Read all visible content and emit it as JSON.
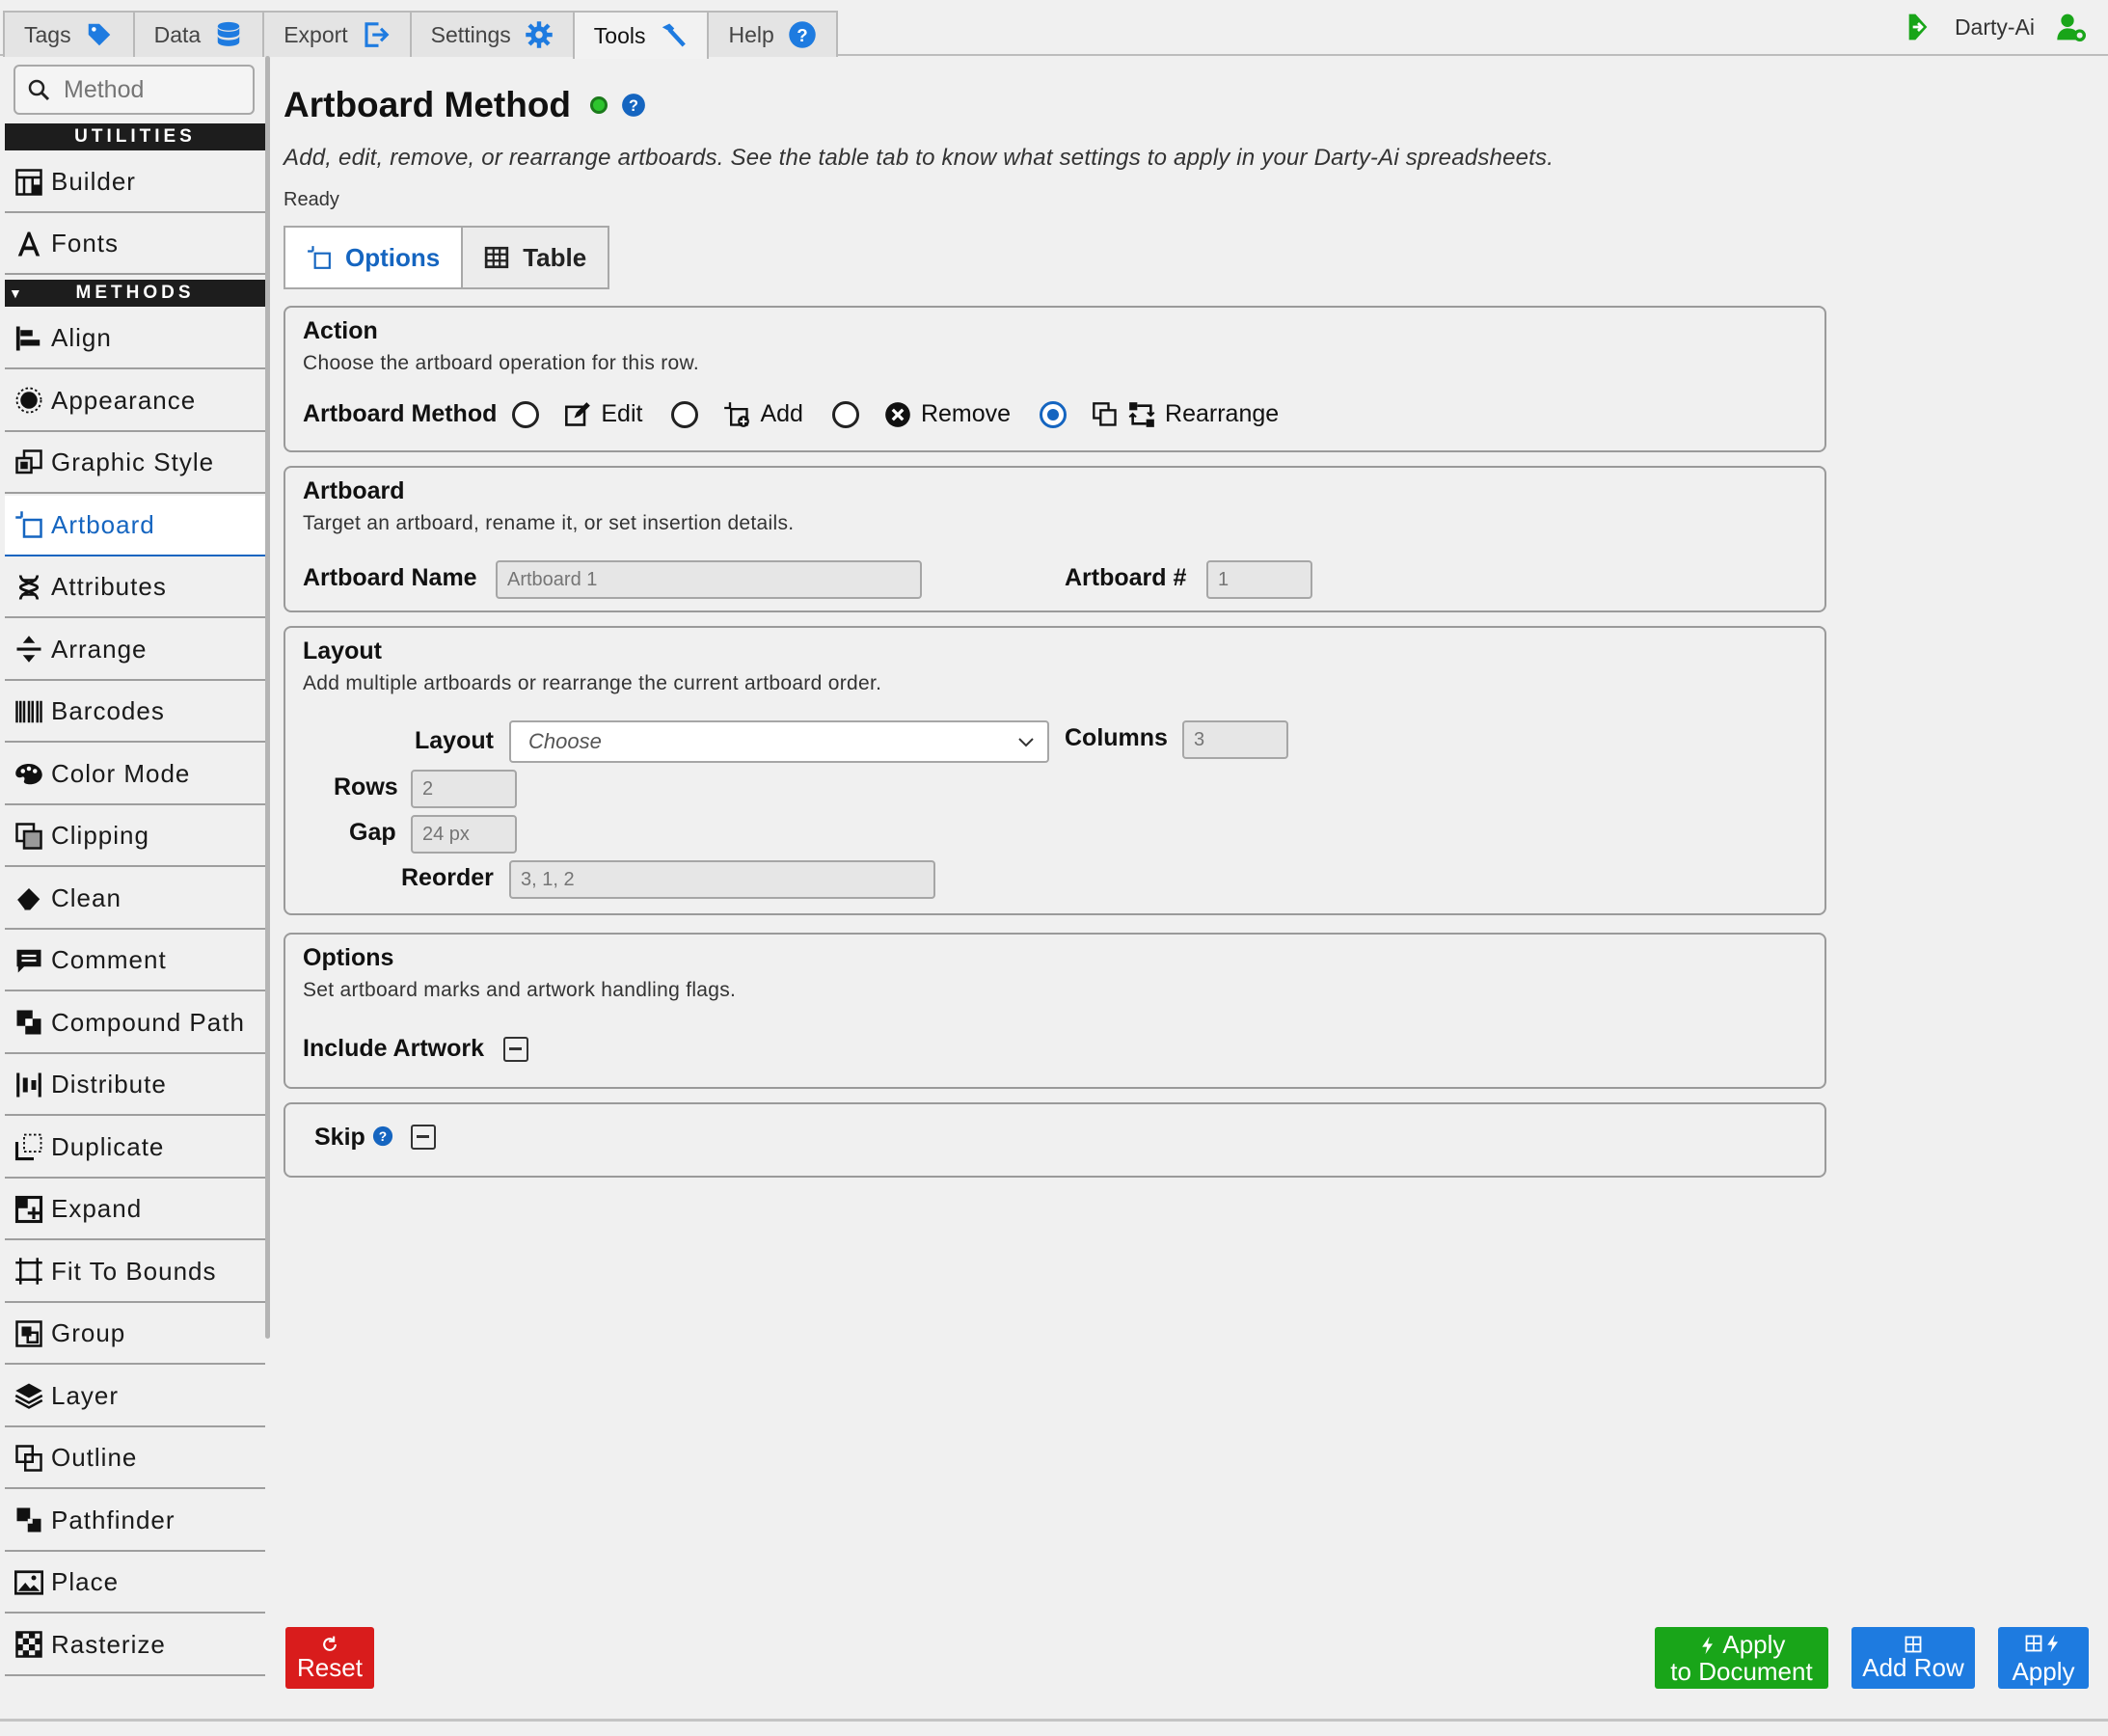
{
  "top_tabs": [
    {
      "label": "Tags",
      "icon": "tag-icon"
    },
    {
      "label": "Data",
      "icon": "database-icon"
    },
    {
      "label": "Export",
      "icon": "export-icon"
    },
    {
      "label": "Settings",
      "icon": "gear-icon"
    },
    {
      "label": "Tools",
      "icon": "hammer-icon",
      "active": true
    },
    {
      "label": "Help",
      "icon": "help-icon"
    }
  ],
  "user": {
    "name": "Darty-Ai"
  },
  "sidebar": {
    "search_placeholder": "Method",
    "utilities_header": "UTILITIES",
    "methods_header": "METHODS",
    "utilities": [
      {
        "label": "Builder",
        "icon": "builder-icon"
      },
      {
        "label": "Fonts",
        "icon": "font-icon"
      }
    ],
    "methods": [
      {
        "label": "Align",
        "icon": "align-icon"
      },
      {
        "label": "Appearance",
        "icon": "appearance-icon"
      },
      {
        "label": "Graphic Style",
        "icon": "graphic-style-icon"
      },
      {
        "label": "Artboard",
        "icon": "artboard-icon",
        "active": true
      },
      {
        "label": "Attributes",
        "icon": "dna-icon"
      },
      {
        "label": "Arrange",
        "icon": "arrange-icon"
      },
      {
        "label": "Barcodes",
        "icon": "barcode-icon"
      },
      {
        "label": "Color Mode",
        "icon": "palette-icon"
      },
      {
        "label": "Clipping",
        "icon": "clipping-icon"
      },
      {
        "label": "Clean",
        "icon": "eraser-icon"
      },
      {
        "label": "Comment",
        "icon": "comment-icon"
      },
      {
        "label": "Compound Path",
        "icon": "compound-path-icon"
      },
      {
        "label": "Distribute",
        "icon": "distribute-icon"
      },
      {
        "label": "Duplicate",
        "icon": "duplicate-icon"
      },
      {
        "label": "Expand",
        "icon": "expand-icon"
      },
      {
        "label": "Fit To Bounds",
        "icon": "fit-bounds-icon"
      },
      {
        "label": "Group",
        "icon": "group-icon"
      },
      {
        "label": "Layer",
        "icon": "layers-icon"
      },
      {
        "label": "Outline",
        "icon": "outline-icon"
      },
      {
        "label": "Pathfinder",
        "icon": "pathfinder-icon"
      },
      {
        "label": "Place",
        "icon": "image-icon"
      },
      {
        "label": "Rasterize",
        "icon": "checker-icon"
      }
    ]
  },
  "main": {
    "title": "Artboard Method",
    "description": "Add, edit, remove, or rearrange artboards. See the table tab to know what settings to apply in your Darty-Ai spreadsheets.",
    "status": "Ready",
    "view_tabs": [
      {
        "label": "Options",
        "active": true
      },
      {
        "label": "Table"
      }
    ],
    "action": {
      "title": "Action",
      "description": "Choose the artboard operation for this row.",
      "method_label": "Artboard Method",
      "options": [
        {
          "label": "Edit",
          "checked": false
        },
        {
          "label": "Add",
          "checked": false
        },
        {
          "label": "Remove",
          "checked": false
        },
        {
          "label": "Rearrange",
          "checked": true
        }
      ]
    },
    "artboard": {
      "title": "Artboard",
      "description": "Target an artboard, rename it, or set insertion details.",
      "name_label": "Artboard Name",
      "name_placeholder": "Artboard 1",
      "number_label": "Artboard #",
      "number_placeholder": "1"
    },
    "layout": {
      "title": "Layout",
      "description": "Add multiple artboards or rearrange the current artboard order.",
      "layout_label": "Layout",
      "layout_value": "Choose",
      "columns_label": "Columns",
      "columns_placeholder": "3",
      "rows_label": "Rows",
      "rows_placeholder": "2",
      "gap_label": "Gap",
      "gap_placeholder": "24 px",
      "reorder_label": "Reorder",
      "reorder_placeholder": "3, 1, 2"
    },
    "options": {
      "title": "Options",
      "description": "Set artboard marks and artwork handling flags.",
      "include_artwork_label": "Include Artwork"
    },
    "skip": {
      "label": "Skip"
    }
  },
  "buttons": {
    "reset": "Reset",
    "apply_doc_line1": "Apply",
    "apply_doc_line2": "to Document",
    "add_row": "Add Row",
    "apply": "Apply"
  },
  "colors": {
    "accent": "#1565c0",
    "status_ready": "#2ec42e",
    "reset": "#d91c1c",
    "apply_document": "#19a519",
    "primary_button": "#1e7be0"
  }
}
